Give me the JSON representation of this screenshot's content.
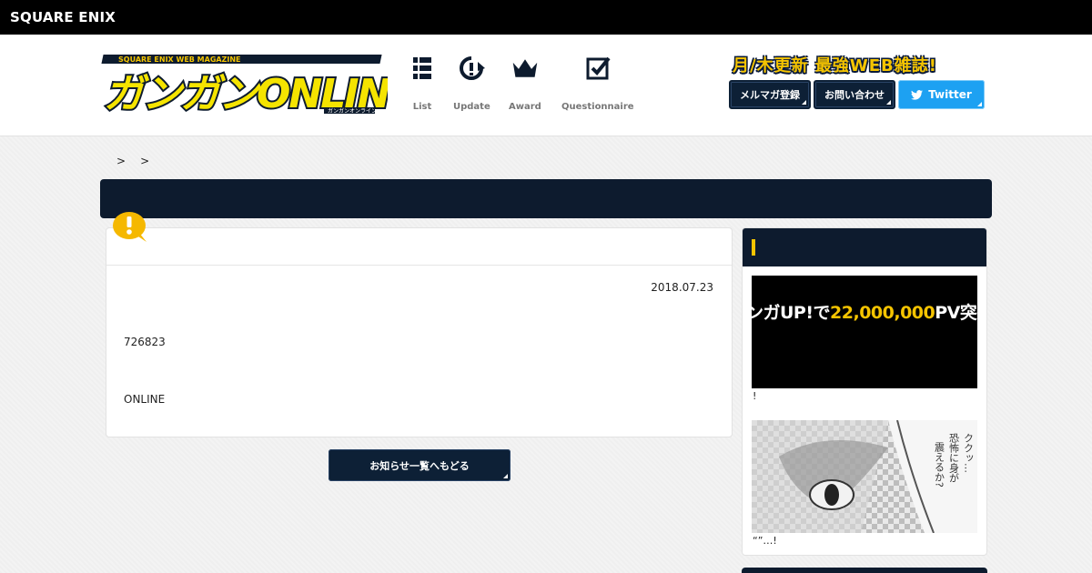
{
  "brand": {
    "corporate_logo": "SQUARE ENIX",
    "site_logo_alt": "ガンガンONLINE"
  },
  "nav": [
    {
      "label": "List",
      "icon": "list-icon"
    },
    {
      "label": "Update",
      "icon": "update-icon"
    },
    {
      "label": "Award",
      "icon": "crown-icon"
    },
    {
      "label": "Questionnaire",
      "icon": "checkbox-icon"
    }
  ],
  "header": {
    "tagline": "月/木更新 最強WEB雑誌!",
    "mailmag_label": "メルマガ登録",
    "contact_label": "お問い合わせ",
    "twitter_label": "Twitter"
  },
  "breadcrumb": {
    "sep1": ">",
    "sep2": ">"
  },
  "article": {
    "date": "2018.07.23",
    "para1": "726823",
    "para2": "ONLINE",
    "back_label": "お知らせ一覧へもどる"
  },
  "sidebar": {
    "banner1_text_a": "ンガUP!で",
    "banner1_text_b": "22,000,000",
    "banner1_text_c": "PV突破",
    "caption1": "!",
    "banner2_text": "ククッ… 恐怖に身が 震えるか?",
    "caption2": "“”…!"
  },
  "colors": {
    "navy": "#0d1b2e",
    "accent_yellow": "#f5c400",
    "twitter_blue": "#1da1f2"
  }
}
